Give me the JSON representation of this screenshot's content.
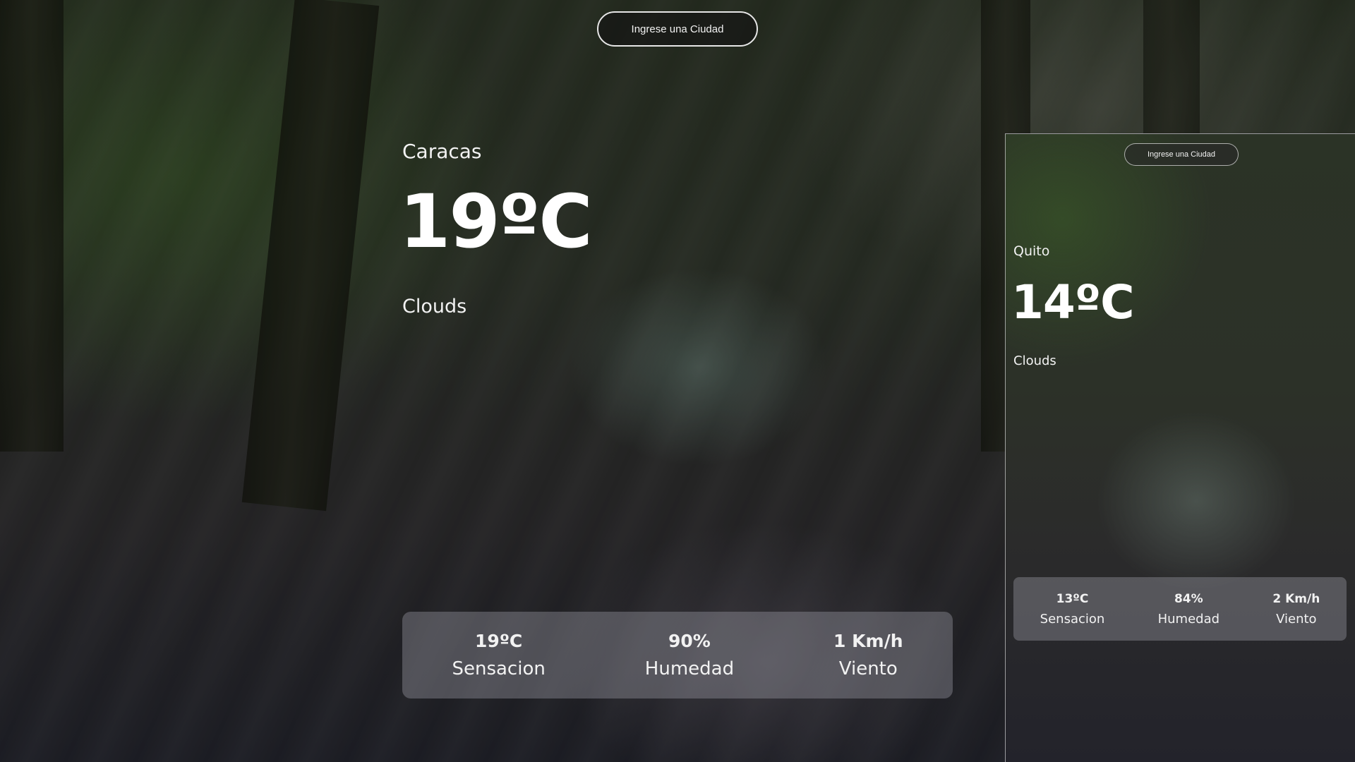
{
  "main": {
    "search": {
      "label": "Ingrese una Ciudad"
    },
    "city": "Caracas",
    "temperature": "19ºC",
    "description": "Clouds",
    "stats": [
      {
        "value": "19ºC",
        "label": "Sensacion"
      },
      {
        "value": "90%",
        "label": "Humedad"
      },
      {
        "value": "1 Km/h",
        "label": "Viento"
      }
    ]
  },
  "mobile": {
    "search": {
      "label": "Ingrese una Ciudad"
    },
    "city": "Quito",
    "temperature": "14ºC",
    "description": "Clouds",
    "stats": [
      {
        "value": "13ºC",
        "label": "Sensacion"
      },
      {
        "value": "84%",
        "label": "Humedad"
      },
      {
        "value": "2 Km/h",
        "label": "Viento"
      }
    ]
  }
}
